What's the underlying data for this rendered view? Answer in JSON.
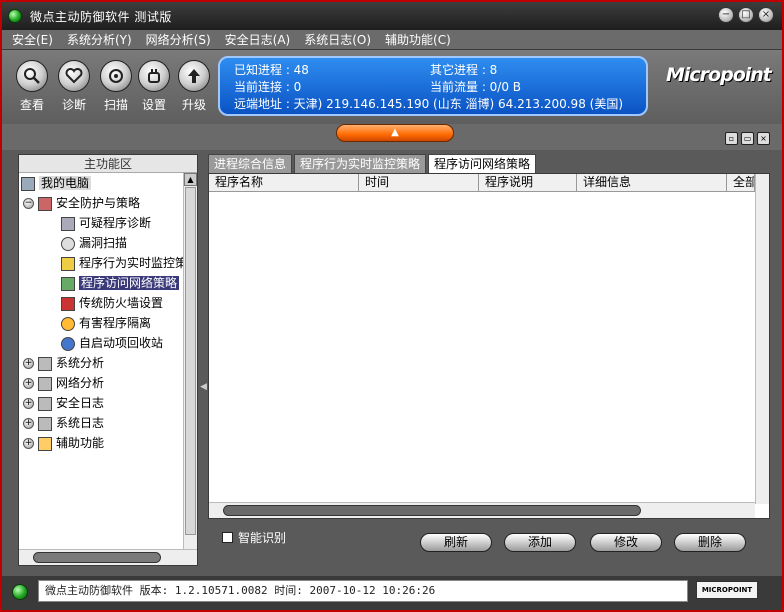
{
  "window": {
    "title": "微点主动防御软件  测试版",
    "controls": [
      "−",
      "□",
      "×"
    ]
  },
  "menu": [
    {
      "label": "安全(E)"
    },
    {
      "label": "系统分析(Y)"
    },
    {
      "label": "网络分析(S)"
    },
    {
      "label": "安全日志(A)"
    },
    {
      "label": "系统日志(O)"
    },
    {
      "label": "辅助功能(C)"
    }
  ],
  "toolbar": {
    "buttons": [
      {
        "label": "查看",
        "icon": "magnifier-icon"
      },
      {
        "label": "诊断",
        "icon": "heart-icon"
      },
      {
        "label": "扫描",
        "icon": "scan-icon"
      },
      {
        "label": "设置",
        "icon": "hand-icon"
      },
      {
        "label": "升级",
        "icon": "upgrade-icon"
      }
    ]
  },
  "info": {
    "known_procs": "已知进程 : 48",
    "other_procs": "其它进程 : 8",
    "current_conn": "当前连接 : 0",
    "current_flow": "当前流量 : 0/0 B",
    "remote_addr": "远端地址 : 天津)   219.146.145.190 (山东 淄博)   64.213.200.98 (美国)"
  },
  "logo": {
    "text": "Micropoint"
  },
  "left_panel": {
    "header": "主功能区",
    "tree": [
      {
        "label": "我的电脑",
        "level": 0,
        "type": "root"
      },
      {
        "label": "安全防护与策略",
        "level": 1,
        "exp": "−"
      },
      {
        "label": "可疑程序诊断",
        "level": 2
      },
      {
        "label": "漏洞扫描",
        "level": 2
      },
      {
        "label": "程序行为实时监控策略",
        "level": 2
      },
      {
        "label": "程序访问网络策略",
        "level": 2,
        "selected": true
      },
      {
        "label": "传统防火墙设置",
        "level": 2
      },
      {
        "label": "有害程序隔离",
        "level": 2
      },
      {
        "label": "自启动项回收站",
        "level": 2
      },
      {
        "label": "系统分析",
        "level": 1,
        "exp": "+"
      },
      {
        "label": "网络分析",
        "level": 1,
        "exp": "+"
      },
      {
        "label": "安全日志",
        "level": 1,
        "exp": "+"
      },
      {
        "label": "系统日志",
        "level": 1,
        "exp": "+"
      },
      {
        "label": "辅助功能",
        "level": 1,
        "exp": "+"
      }
    ]
  },
  "tabs": [
    {
      "label": "进程综合信息"
    },
    {
      "label": "程序行为实时监控策略"
    },
    {
      "label": "程序访问网络策略",
      "active": true
    }
  ],
  "table": {
    "columns": [
      "程序名称",
      "时间",
      "程序说明",
      "详细信息",
      "全部"
    ]
  },
  "bottom": {
    "checkbox_label": "智能识别",
    "buttons": [
      "刷新",
      "添加",
      "修改",
      "删除"
    ]
  },
  "status": {
    "text": "微点主动防御软件    版本: 1.2.10571.0082    时间: 2007-10-12 10:26:26",
    "logo": "MICROPOINT"
  }
}
